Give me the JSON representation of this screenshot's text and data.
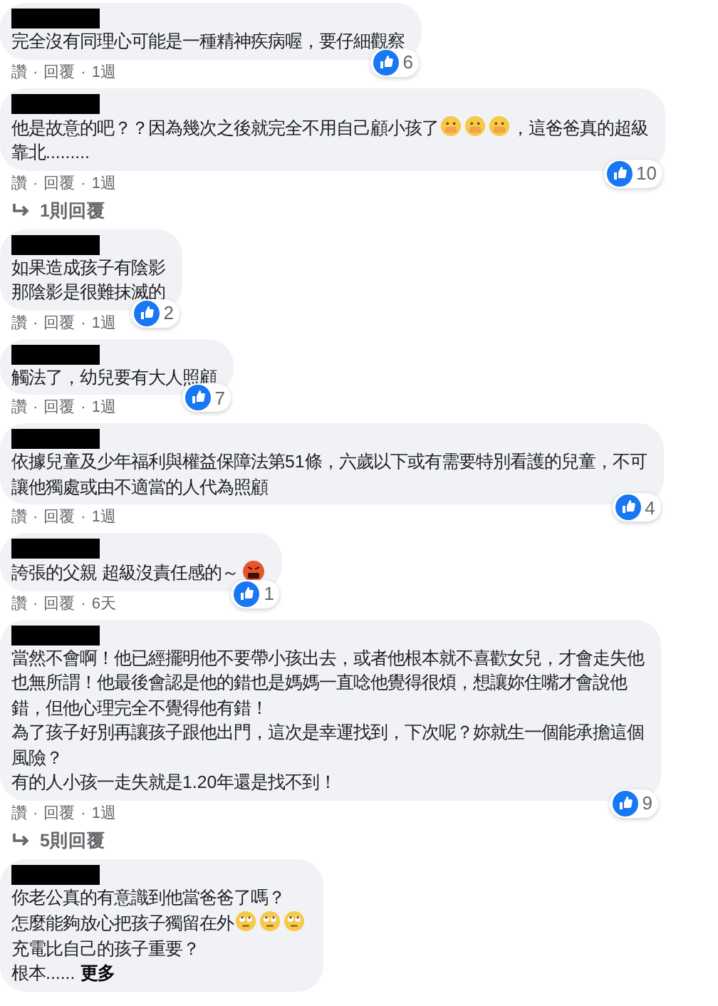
{
  "comments": [
    {
      "name_redacted": true,
      "lines": [
        [
          {
            "kind": "text",
            "text": "完全沒有同理心可能是一種精神疾病喔，要仔細觀察"
          }
        ]
      ],
      "likes": "6",
      "separator": "·",
      "actions": [
        "讚",
        "回覆",
        "1週"
      ]
    },
    {
      "name_redacted": true,
      "lines": [
        [
          {
            "kind": "text",
            "text": "他是故意的吧？？因為幾次之後就完全不用自己顧小孩了"
          },
          {
            "kind": "mask"
          },
          {
            "kind": "mask"
          },
          {
            "kind": "mask"
          },
          {
            "kind": "text",
            "text": "，這爸爸真的超級"
          }
        ],
        [
          {
            "kind": "text",
            "text": "靠北........."
          }
        ]
      ],
      "likes": "10",
      "separator": "·",
      "actions": [
        "讚",
        "回覆",
        "1週"
      ],
      "replies": "1則回覆"
    },
    {
      "name_redacted": true,
      "lines": [
        [
          {
            "kind": "text",
            "text": "如果造成孩子有陰影"
          }
        ],
        [
          {
            "kind": "text",
            "text": "那陰影是很難抹滅的"
          }
        ]
      ],
      "likes": "2",
      "separator": "·",
      "actions": [
        "讚",
        "回覆",
        "1週"
      ]
    },
    {
      "name_redacted": true,
      "lines": [
        [
          {
            "kind": "text",
            "text": "觸法了，幼兒要有大人照顧"
          }
        ]
      ],
      "likes": "7",
      "separator": "·",
      "actions": [
        "讚",
        "回覆",
        "1週"
      ]
    },
    {
      "name_redacted": true,
      "lines": [
        [
          {
            "kind": "text",
            "text": "依據兒童及少年福利與權益保障法第51條，六歲以下或有需要特別看護的兒童，不可"
          }
        ],
        [
          {
            "kind": "text",
            "text": "讓他獨處或由不適當的人代為照顧"
          }
        ]
      ],
      "likes": "4",
      "separator": "·",
      "actions": [
        "讚",
        "回覆",
        "1週"
      ]
    },
    {
      "name_redacted": true,
      "lines": [
        [
          {
            "kind": "text",
            "text": "誇張的父親 超級沒責任感的～"
          },
          {
            "kind": "cursing"
          }
        ]
      ],
      "likes": "1",
      "separator": "·",
      "actions": [
        "讚",
        "回覆",
        "6天"
      ]
    },
    {
      "name_redacted": true,
      "lines": [
        [
          {
            "kind": "text",
            "text": "當然不會啊！他已經擺明他不要帶小孩出去，或者他根本就不喜歡女兒，才會走失他"
          }
        ],
        [
          {
            "kind": "text",
            "text": "也無所謂！他最後會認是他的錯也是媽媽一直唸他覺得很煩，想讓妳住嘴才會說他"
          }
        ],
        [
          {
            "kind": "text",
            "text": "錯，但他心理完全不覺得他有錯！"
          }
        ],
        [
          {
            "kind": "text",
            "text": "為了孩子好別再讓孩子跟他出門，這次是幸運找到，下次呢？妳就生一個能承擔這個"
          }
        ],
        [
          {
            "kind": "text",
            "text": "風險？"
          }
        ],
        [
          {
            "kind": "text",
            "text": "有的人小孩一走失就是1.20年還是找不到！"
          }
        ]
      ],
      "likes": "9",
      "separator": "·",
      "actions": [
        "讚",
        "回覆",
        "1週"
      ],
      "replies": "5則回覆"
    },
    {
      "name_redacted": true,
      "lines": [
        [
          {
            "kind": "text",
            "text": "你老公真的有意識到他當爸爸了嗎？"
          }
        ],
        [
          {
            "kind": "text",
            "text": "怎麼能夠放心把孩子獨留在外"
          },
          {
            "kind": "eyeroll"
          },
          {
            "kind": "eyeroll"
          },
          {
            "kind": "eyeroll"
          }
        ],
        [
          {
            "kind": "text",
            "text": "充電比自己的孩子重要？"
          }
        ],
        [
          {
            "kind": "text",
            "text": "根本......"
          },
          {
            "kind": "link",
            "text": "更多"
          }
        ]
      ]
    }
  ]
}
